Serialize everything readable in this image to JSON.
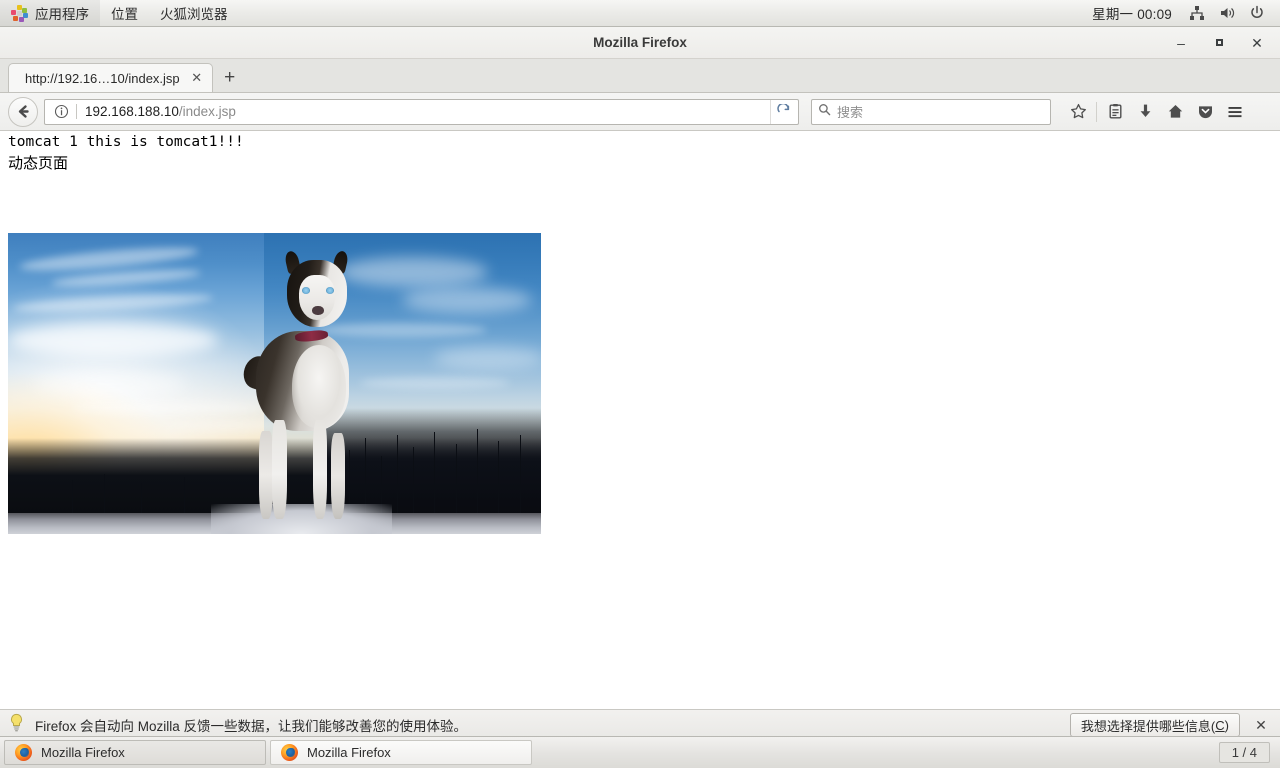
{
  "desktop": {
    "panel": {
      "apps_icon": "applications-pinwheel-icon",
      "menus": [
        "应用程序",
        "位置",
        "火狐浏览器"
      ],
      "clock": "星期一 00:09",
      "tray": [
        "network-icon",
        "volume-icon",
        "power-icon"
      ]
    },
    "taskbar": {
      "items": [
        {
          "label": "Mozilla Firefox",
          "icon": "firefox-icon",
          "active": true
        },
        {
          "label": "Mozilla Firefox",
          "icon": "firefox-icon",
          "active": false
        }
      ],
      "workspace": "1 / 4"
    }
  },
  "browser": {
    "window_title": "Mozilla Firefox",
    "window_controls": {
      "minimize": "–",
      "maximize": "▫",
      "close": "✕"
    },
    "tabs": [
      {
        "title": "http://192.16…10/index.jsp",
        "close": "✕"
      }
    ],
    "new_tab_label": "+",
    "toolbar": {
      "back_icon": "back-arrow-icon",
      "identity_icon": "info-circle-icon",
      "url_host": "192.168.188.10",
      "url_path": "/index.jsp",
      "reload_icon": "reload-icon",
      "search_placeholder": "搜索",
      "search_icon": "search-icon",
      "icons": [
        "star-icon",
        "library-icon",
        "downloads-icon",
        "home-icon",
        "pocket-icon",
        "hamburger-menu-icon"
      ]
    },
    "notification": {
      "icon": "lightbulb-icon",
      "text": "Firefox 会自动向 Mozilla 反馈一些数据，让我们能够改善您的使用体验。",
      "button_label": "我想选择提供哪些信息(",
      "button_accesskey": "C",
      "button_label_end": ")",
      "close": "✕"
    }
  },
  "page": {
    "line1": "tomcat 1 this is tomcat1!!!",
    "line2": "动态页面",
    "image_alt": "siberian-husky-standing-on-snow-at-sunset"
  },
  "colors": {
    "accent": "#3f7fbe",
    "panel_bg": "#ebebe8",
    "tab_bg": "#e4e4e1",
    "text": "#2b2b2b"
  }
}
